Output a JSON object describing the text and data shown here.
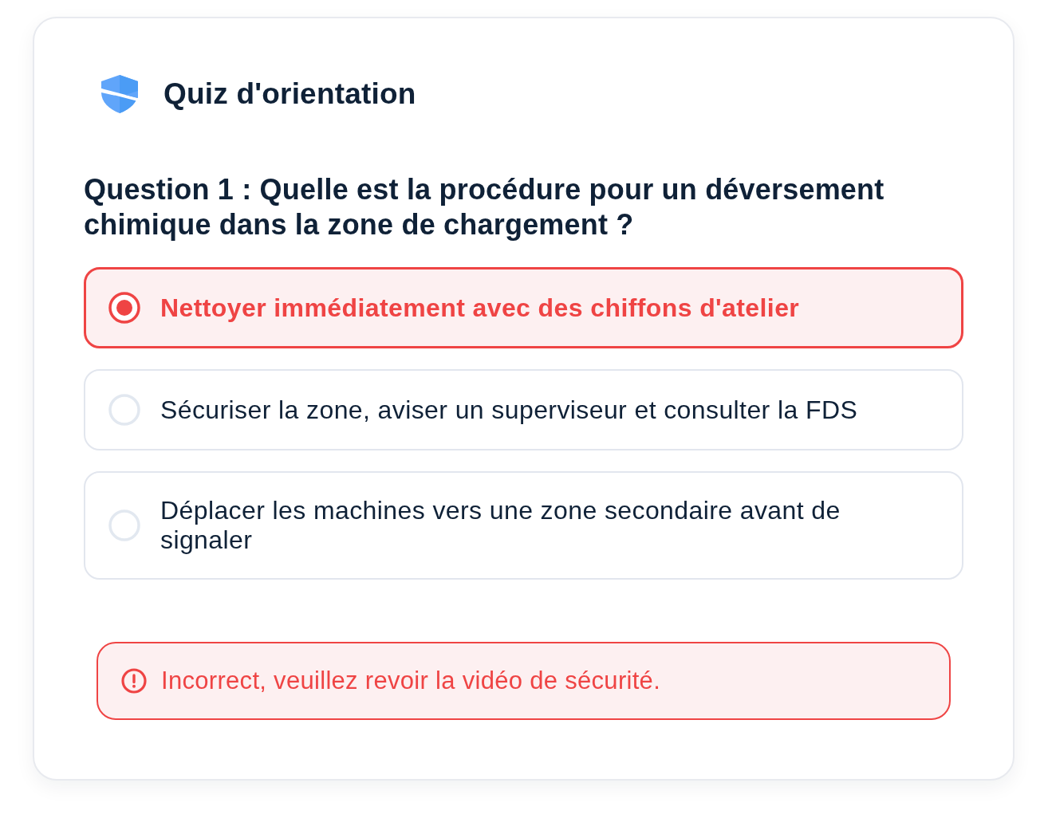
{
  "header": {
    "title": "Quiz d'orientation"
  },
  "question": {
    "text": "Question 1 : Quelle est la procédure pour un déversement chimique dans la zone de chargement ?"
  },
  "options": [
    {
      "text": "Nettoyer immédiatement avec des chiffons d'atelier",
      "selected": true
    },
    {
      "text": "Sécuriser la zone, aviser un superviseur et consulter la FDS",
      "selected": false
    },
    {
      "text": "Déplacer les machines vers une zone secondaire avant de signaler",
      "selected": false
    }
  ],
  "feedback": {
    "kind": "error",
    "text": "Incorrect, veuillez revoir la vidéo de sécurité."
  }
}
